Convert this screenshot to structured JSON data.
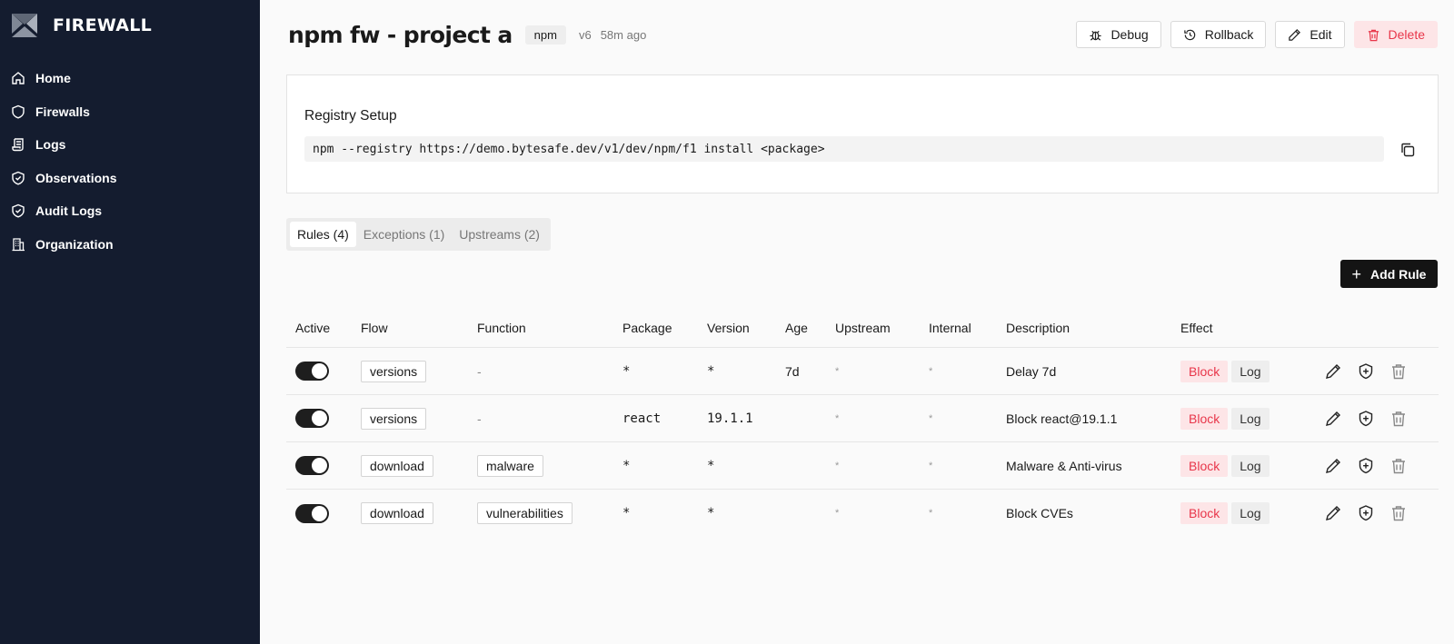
{
  "brand": {
    "name": "FIREWALL"
  },
  "nav": [
    {
      "label": "Home",
      "icon": "home-icon"
    },
    {
      "label": "Firewalls",
      "icon": "shield-icon"
    },
    {
      "label": "Logs",
      "icon": "scroll-icon"
    },
    {
      "label": "Observations",
      "icon": "shield-check-icon"
    },
    {
      "label": "Audit Logs",
      "icon": "shield-check-icon"
    },
    {
      "label": "Organization",
      "icon": "building-icon"
    }
  ],
  "header": {
    "title": "npm fw - project a",
    "registry_badge": "npm",
    "version": "v6",
    "updated": "58m ago",
    "actions": {
      "debug": "Debug",
      "rollback": "Rollback",
      "edit": "Edit",
      "delete": "Delete"
    }
  },
  "registry_setup": {
    "title": "Registry Setup",
    "command": "npm --registry https://demo.bytesafe.dev/v1/dev/npm/f1 install <package>"
  },
  "tabs": [
    {
      "label": "Rules (4)",
      "active": true
    },
    {
      "label": "Exceptions (1)",
      "active": false
    },
    {
      "label": "Upstreams (2)",
      "active": false
    }
  ],
  "add_rule_label": "Add Rule",
  "table": {
    "columns": [
      "Active",
      "Flow",
      "Function",
      "Package",
      "Version",
      "Age",
      "Upstream",
      "Internal",
      "Description",
      "Effect"
    ],
    "rows": [
      {
        "active": true,
        "flow": "versions",
        "function": "-",
        "package": "*",
        "version": "*",
        "age": "7d",
        "upstream": "*",
        "internal": "*",
        "description": "Delay 7d",
        "effect_block": "Block",
        "effect_log": "Log"
      },
      {
        "active": true,
        "flow": "versions",
        "function": "-",
        "package": "react",
        "version": "19.1.1",
        "age": "",
        "upstream": "*",
        "internal": "*",
        "description": "Block react@19.1.1",
        "effect_block": "Block",
        "effect_log": "Log"
      },
      {
        "active": true,
        "flow": "download",
        "function": "malware",
        "package": "*",
        "version": "*",
        "age": "",
        "upstream": "*",
        "internal": "*",
        "description": "Malware & Anti-virus",
        "effect_block": "Block",
        "effect_log": "Log"
      },
      {
        "active": true,
        "flow": "download",
        "function": "vulnerabilities",
        "package": "*",
        "version": "*",
        "age": "",
        "upstream": "*",
        "internal": "*",
        "description": "Block CVEs",
        "effect_block": "Block",
        "effect_log": "Log"
      }
    ]
  },
  "colors": {
    "sidebar": "#141c2f",
    "danger": "#e8364a",
    "danger_bg": "#fde5e7",
    "primary_button": "#141414"
  }
}
